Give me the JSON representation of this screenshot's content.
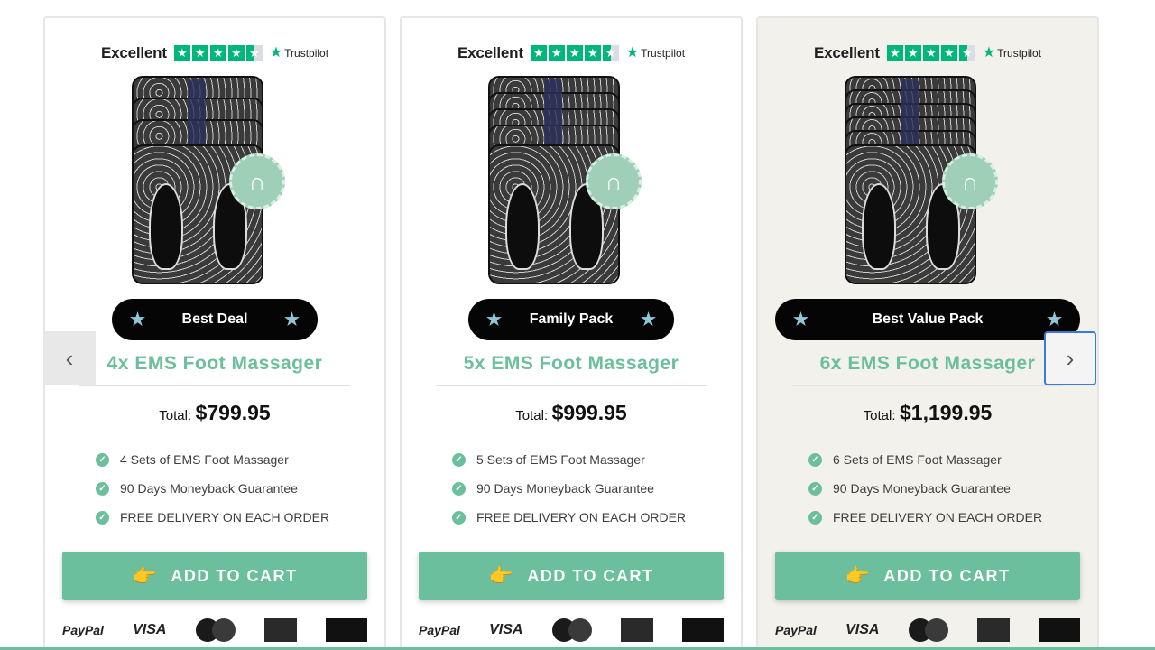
{
  "trustpilot": {
    "rating_text": "Excellent",
    "brand": "Trustpilot",
    "stars": 4.5
  },
  "products": [
    {
      "badge": "Best Deal",
      "title": "4x EMS Foot Massager",
      "total_label": "Total:",
      "total_value": "$799.95",
      "features": [
        "4 Sets of EMS Foot Massager",
        "90 Days Moneyback Guarantee",
        "FREE DELIVERY ON EACH ORDER"
      ],
      "cart_label": "ADD TO CART"
    },
    {
      "badge": "Family Pack",
      "title": "5x EMS Foot Massager",
      "total_label": "Total:",
      "total_value": "$999.95",
      "features": [
        "5 Sets of EMS Foot Massager",
        "90 Days Moneyback Guarantee",
        "FREE DELIVERY ON EACH ORDER"
      ],
      "cart_label": "ADD TO CART"
    },
    {
      "badge": "Best Value Pack",
      "title": "6x EMS Foot Massager",
      "total_label": "Total:",
      "total_value": "$1,199.95",
      "features": [
        "6 Sets of EMS Foot Massager",
        "90 Days Moneyback Guarantee",
        "FREE DELIVERY ON EACH ORDER"
      ],
      "cart_label": "ADD TO CART"
    }
  ],
  "payment": {
    "paypal": "PayPal",
    "visa": "VISA"
  },
  "nav": {
    "prev": "‹",
    "next": "›"
  },
  "colors": {
    "accent": "#6cbf9c",
    "trustpilot": "#00b67a",
    "badge_bg": "#050505",
    "highlight_card": "#f3f1ec"
  }
}
